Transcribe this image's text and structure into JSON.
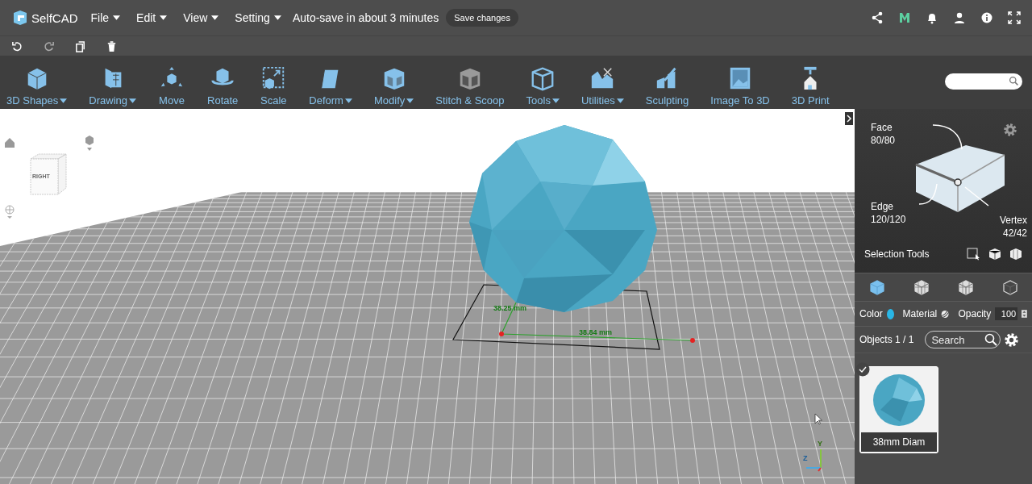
{
  "header": {
    "logo": "SelfCAD",
    "menus": [
      {
        "label": "File"
      },
      {
        "label": "Edit"
      },
      {
        "label": "View"
      },
      {
        "label": "Setting"
      }
    ],
    "autosave": "Auto-save in about 3 minutes",
    "save_button": "Save changes"
  },
  "toolbar": [
    {
      "label": "3D Shapes",
      "dropdown": true
    },
    {
      "label": "Drawing",
      "dropdown": true
    },
    {
      "label": "Move",
      "dropdown": false
    },
    {
      "label": "Rotate",
      "dropdown": false
    },
    {
      "label": "Scale",
      "dropdown": false
    },
    {
      "label": "Deform",
      "dropdown": true
    },
    {
      "label": "Modify",
      "dropdown": true
    },
    {
      "label": "Stitch & Scoop",
      "dropdown": false
    },
    {
      "label": "Tools",
      "dropdown": true
    },
    {
      "label": "Utilities",
      "dropdown": true
    },
    {
      "label": "Sculpting",
      "dropdown": false
    },
    {
      "label": "Image To 3D",
      "dropdown": false
    },
    {
      "label": "3D Print",
      "dropdown": false
    }
  ],
  "viewport": {
    "viewcube_label": "RIGHT",
    "measurements": [
      "38.25 mm",
      "38.84 mm"
    ],
    "axes": [
      "Y",
      "Z"
    ]
  },
  "panel": {
    "face": {
      "label": "Face",
      "count": "80/80"
    },
    "edge": {
      "label": "Edge",
      "count": "120/120"
    },
    "vertex": {
      "label": "Vertex",
      "count": "42/42"
    },
    "selection_tools": "Selection Tools",
    "modes": [
      {
        "selected": true
      },
      {
        "selected": false
      },
      {
        "selected": false
      },
      {
        "selected": false
      }
    ],
    "color_label": "Color",
    "color": "#29b6e6",
    "material_label": "Material",
    "opacity_label": "Opacity",
    "opacity": "100",
    "objects_label": "Objects 1 / 1",
    "search_placeholder": "Search",
    "objects": [
      {
        "name": "38mm Diam",
        "selected": true
      }
    ]
  }
}
